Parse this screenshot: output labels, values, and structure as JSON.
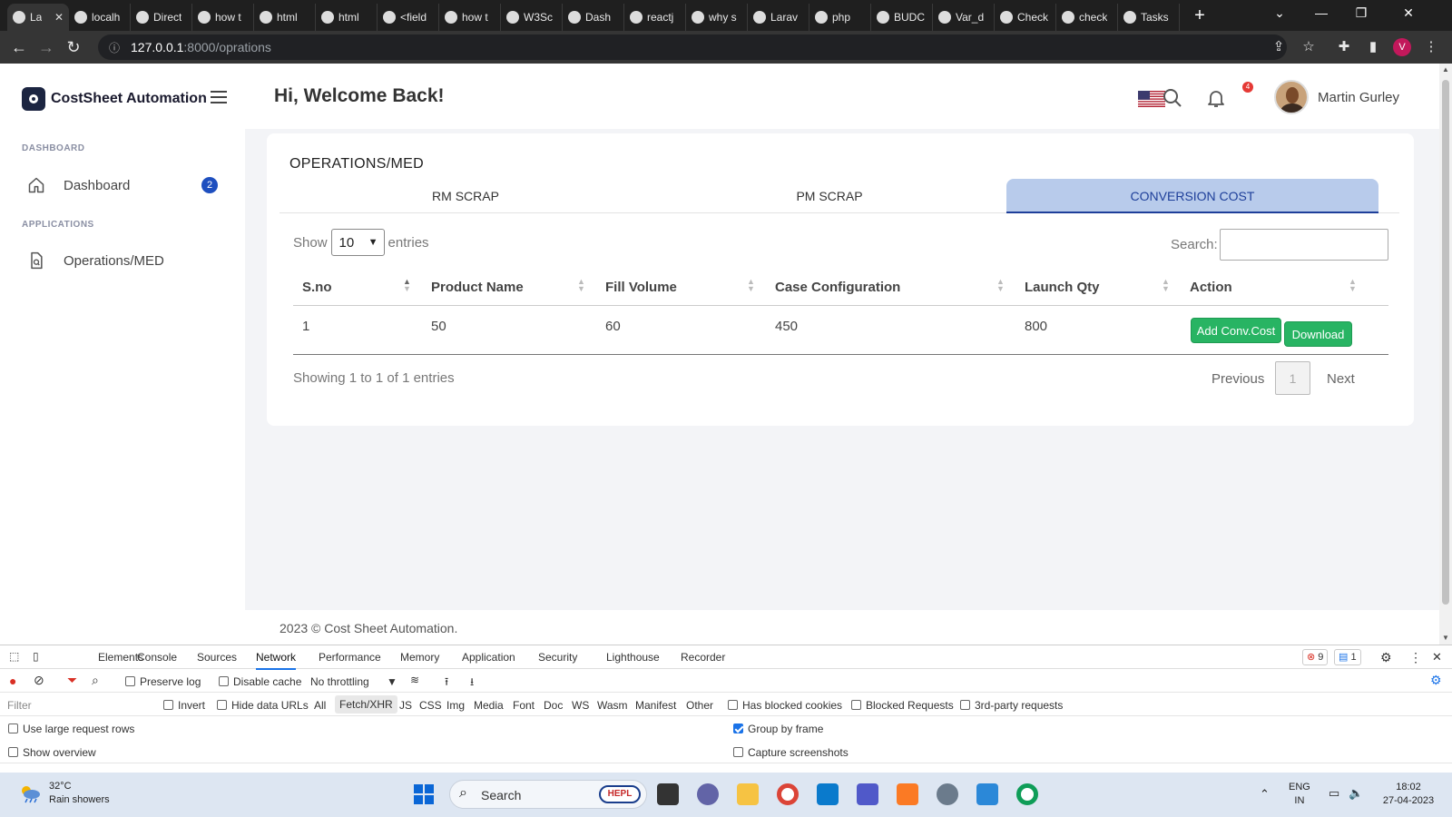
{
  "browser": {
    "tabs": [
      {
        "label": "La",
        "active": true
      },
      {
        "label": "localh"
      },
      {
        "label": "Direct"
      },
      {
        "label": "how t"
      },
      {
        "label": "html"
      },
      {
        "label": "html"
      },
      {
        "label": "<field"
      },
      {
        "label": "how t"
      },
      {
        "label": "W3Sc"
      },
      {
        "label": "Dash"
      },
      {
        "label": "reactj"
      },
      {
        "label": "why s"
      },
      {
        "label": "Larav"
      },
      {
        "label": "php"
      },
      {
        "label": "BUDC"
      },
      {
        "label": "Var_d"
      },
      {
        "label": "Check"
      },
      {
        "label": "check"
      },
      {
        "label": "Tasks"
      }
    ],
    "url_host": "127.0.0.1",
    "url_path": ":8000/oprations",
    "profile_initial": "V"
  },
  "sidebar": {
    "brand": "CostSheet Automation",
    "sections": [
      {
        "label": "DASHBOARD"
      },
      {
        "label": "APPLICATIONS"
      }
    ],
    "items": [
      {
        "label": "Dashboard",
        "badge": "2",
        "icon": "home-icon"
      },
      {
        "label": "Operations/MED",
        "icon": "document-icon"
      }
    ]
  },
  "header": {
    "welcome": "Hi, Welcome Back!",
    "notification_count": "4",
    "user_name": "Martin Gurley"
  },
  "card": {
    "title": "OPERATIONS/MED",
    "tabs": [
      {
        "label": "RM SCRAP"
      },
      {
        "label": "PM SCRAP"
      },
      {
        "label": "CONVERSION COST",
        "active": true
      }
    ],
    "show_label": "Show",
    "entries_value": "10",
    "entries_label": "entries",
    "search_label": "Search:",
    "columns": [
      "S.no",
      "Product Name",
      "Fill Volume",
      "Case Configuration",
      "Launch Qty",
      "Action"
    ],
    "rows": [
      {
        "sno": "1",
        "product": "50",
        "fill": "60",
        "case": "450",
        "qty": "800"
      }
    ],
    "actions": {
      "add": "Add Conv.Cost",
      "download": "Download"
    },
    "showing": "Showing 1 to 1 of 1 entries",
    "pagination": {
      "prev": "Previous",
      "page": "1",
      "next": "Next"
    }
  },
  "footer": "2023 © Cost Sheet Automation.",
  "devtools": {
    "tabs": [
      "Elements",
      "Console",
      "Sources",
      "Network",
      "Performance",
      "Memory",
      "Application",
      "Security",
      "Lighthouse",
      "Recorder"
    ],
    "active_tab": "Network",
    "errors": "9",
    "messages": "1",
    "preserve_log": "Preserve log",
    "disable_cache": "Disable cache",
    "throttling": "No throttling",
    "filter_placeholder": "Filter",
    "filter_types": [
      "Invert",
      "Hide data URLs",
      "All",
      "Fetch/XHR",
      "JS",
      "CSS",
      "Img",
      "Media",
      "Font",
      "Doc",
      "WS",
      "Wasm",
      "Manifest",
      "Other"
    ],
    "has_blocked_cookies": "Has blocked cookies",
    "blocked_requests": "Blocked Requests",
    "third_party": "3rd-party requests",
    "large_rows": "Use large request rows",
    "group_by_frame": "Group by frame",
    "show_overview": "Show overview",
    "capture_screenshots": "Capture screenshots"
  },
  "taskbar": {
    "temp": "32°C",
    "weather": "Rain showers",
    "search": "Search",
    "search_badge": "HEPL",
    "lang1": "ENG",
    "lang2": "IN",
    "time": "18:02",
    "date": "27-04-2023"
  },
  "colors": {
    "accent": "#1e3f9a",
    "active_tab_bg": "#b8cbeb",
    "button_green": "#28b463",
    "badge_blue": "#1e4fbf"
  }
}
